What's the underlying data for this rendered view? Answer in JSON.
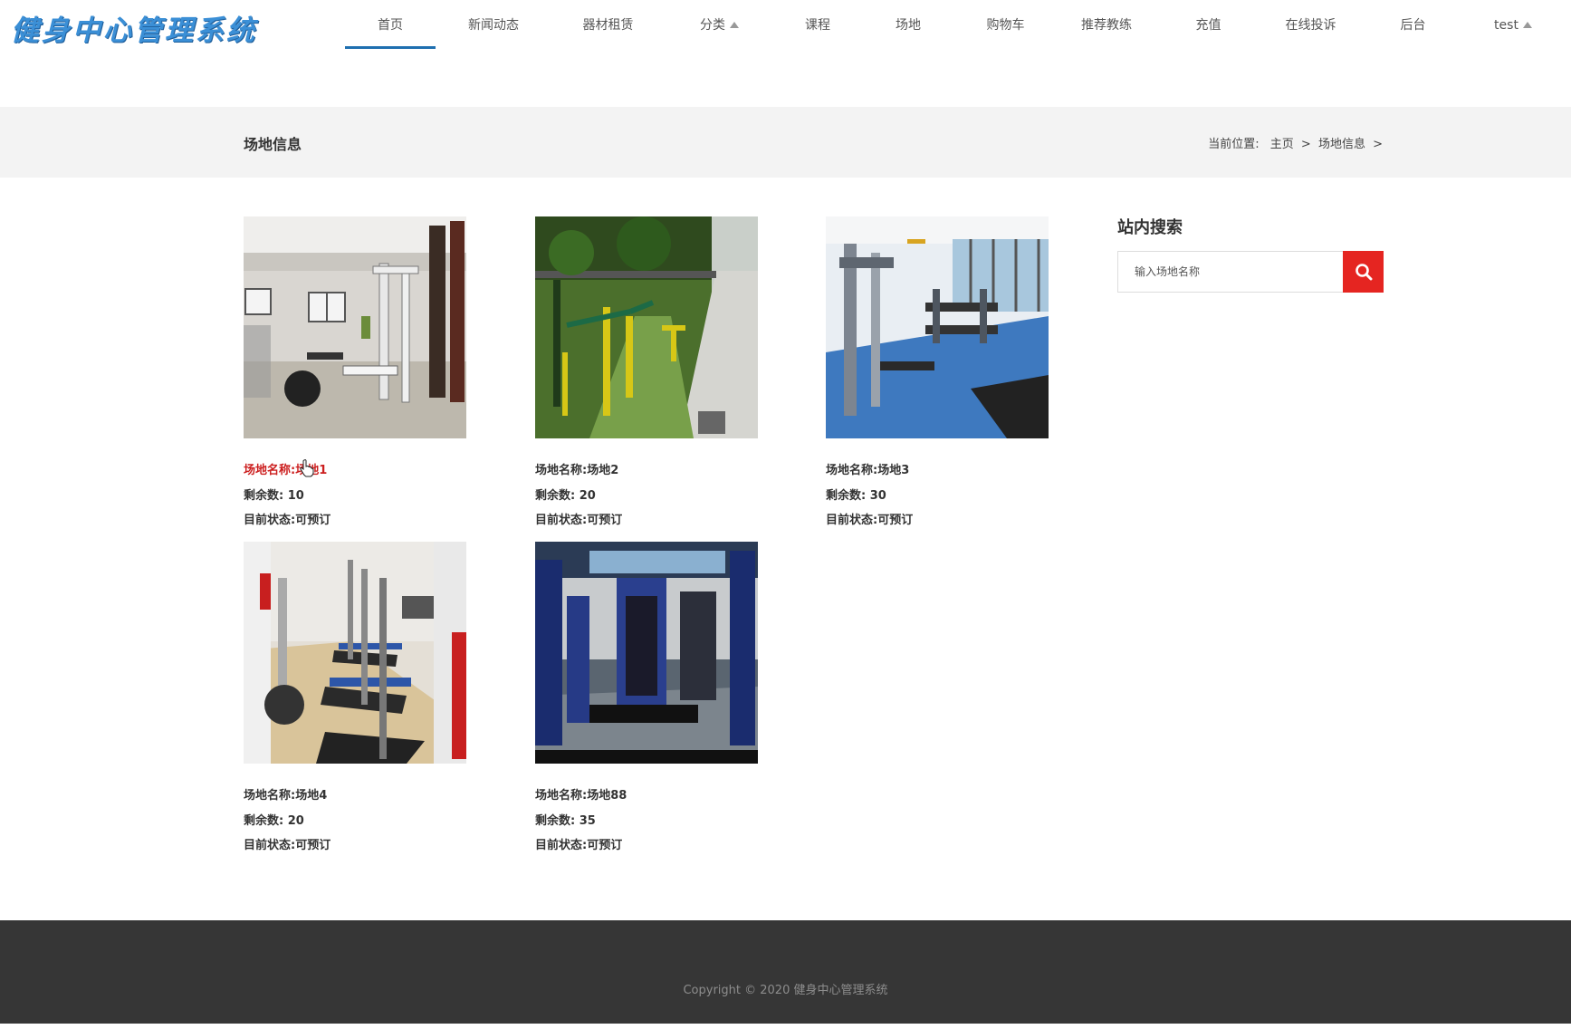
{
  "header": {
    "logo_text": "健身中心管理系统",
    "nav": [
      {
        "label": "首页",
        "active": true
      },
      {
        "label": "新闻动态"
      },
      {
        "label": "器材租赁"
      },
      {
        "label": "分类",
        "caret": true
      },
      {
        "label": "课程"
      },
      {
        "label": "场地"
      },
      {
        "label": "购物车"
      },
      {
        "label": "推荐教练"
      },
      {
        "label": "充值"
      },
      {
        "label": "在线投诉"
      },
      {
        "label": "后台"
      },
      {
        "label": "test",
        "caret": true
      }
    ]
  },
  "band": {
    "title": "场地信息",
    "breadcrumb": {
      "prefix": "当前位置:",
      "home": "主页",
      "sep": ">",
      "current": "场地信息"
    }
  },
  "venues": [
    {
      "name_label": "场地名称:",
      "name": "场地1",
      "remain_label": "剩余数:",
      "remain": "10",
      "status_label": "目前状态:",
      "status": "可预订",
      "highlighted": true,
      "image": "indoor-gym-room-photo"
    },
    {
      "name_label": "场地名称:",
      "name": "场地2",
      "remain_label": "剩余数:",
      "remain": "20",
      "status_label": "目前状态:",
      "status": "可预订",
      "image": "outdoor-fitness-equipment-photo"
    },
    {
      "name_label": "场地名称:",
      "name": "场地3",
      "remain_label": "剩余数:",
      "remain": "30",
      "status_label": "目前状态:",
      "status": "可预订",
      "image": "gym-hall-blue-floor-photo"
    },
    {
      "name_label": "场地名称:",
      "name": "场地4",
      "remain_label": "剩余数:",
      "remain": "20",
      "status_label": "目前状态:",
      "status": "可预订",
      "image": "treadmill-row-photo"
    },
    {
      "name_label": "场地名称:",
      "name": "场地88",
      "remain_label": "剩余数:",
      "remain": "35",
      "status_label": "目前状态:",
      "status": "可预订",
      "image": "strength-machines-photo"
    }
  ],
  "sidebar": {
    "title": "站内搜索",
    "search_placeholder": "输入场地名称",
    "search_icon": "search-icon"
  },
  "footer": {
    "copyright": "Copyright © 2020 健身中心管理系统"
  },
  "colors": {
    "accent_blue": "#1e6fb0",
    "highlight_red": "#cc1f1f",
    "search_red": "#e52521",
    "footer_bg": "#363636",
    "band_bg": "#f3f3f3"
  }
}
